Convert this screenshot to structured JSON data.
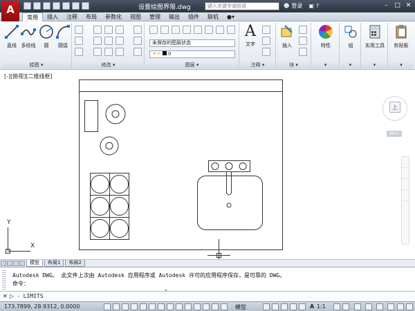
{
  "title_bar": {
    "logo": "A",
    "document_title": "设置绘图界限.dwg",
    "search_placeholder": "键入关键字或短语",
    "login_label": "登录"
  },
  "ribbon_tabs": [
    "常用",
    "插入",
    "注释",
    "布局",
    "参数化",
    "视图",
    "管理",
    "输出",
    "插件",
    "联机"
  ],
  "active_tab": "常用",
  "ribbon": {
    "draw_panel": {
      "label": "绘图 ▾",
      "tools": [
        "直线",
        "多段线",
        "圆",
        "圆弧"
      ]
    },
    "modify_panel": {
      "label": "修改 ▾"
    },
    "layers_panel": {
      "label": "图层 ▾",
      "layer_state": "未保存的图层状态",
      "current_layer": "0"
    },
    "annotation_panel": {
      "label": "注释 ▾",
      "text_tool": "文字"
    },
    "block_panel": {
      "label": "块 ▾",
      "insert_tool": "插入"
    },
    "properties_tool": "特性",
    "group_tool": "组",
    "utilities_tool": "实用工具",
    "clipboard_tool": "剪贴板"
  },
  "viewport_label": "[-][俯视][二维线框]",
  "viewcube": {
    "face": "上",
    "wcs": "WCS"
  },
  "ucs": {
    "y": "Y",
    "x": "X"
  },
  "layout_tabs": [
    "模型",
    "布局1",
    "布局2"
  ],
  "active_layout": "模型",
  "command_history": [
    "Autodesk DWG。  此文件上次由 Autodesk 应用程序或 Autodesk 许可的应用程序保存，是可靠的 DWG。",
    "命令："
  ],
  "command_input": "LIMITS",
  "status": {
    "coordinates": "173.7899, 28.9312, 0.0000",
    "model_label": "模型",
    "scale": "1:1"
  }
}
